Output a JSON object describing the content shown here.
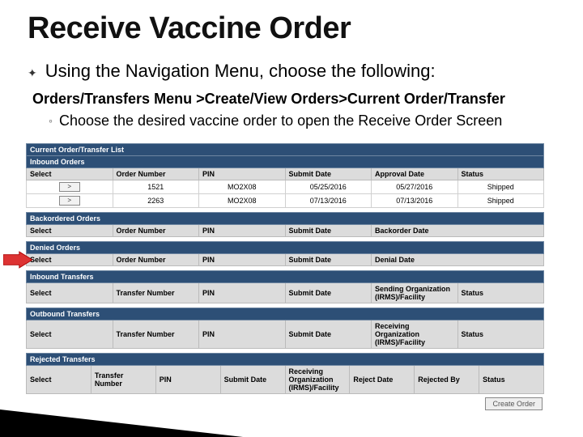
{
  "title": "Receive Vaccine Order",
  "bullet1": "Using the Navigation Menu, choose the following:",
  "menupath": "Orders/Transfers Menu >Create/View Orders>Current Order/Transfer",
  "bullet2": "Choose the desired vaccine order to open the Receive Order Screen",
  "shot": {
    "section1_title": "Current Order/Transfer List",
    "inbound_orders": {
      "title": "Inbound Orders",
      "columns": [
        "Select",
        "Order Number",
        "PIN",
        "Submit Date",
        "Approval Date",
        "Status"
      ],
      "rows": [
        {
          "select": ">",
          "order_number": "1521",
          "pin": "MO2X08",
          "submit_date": "05/25/2016",
          "approval_date": "05/27/2016",
          "status": "Shipped"
        },
        {
          "select": ">",
          "order_number": "2263",
          "pin": "MO2X08",
          "submit_date": "07/13/2016",
          "approval_date": "07/13/2016",
          "status": "Shipped"
        }
      ]
    },
    "backordered_orders": {
      "title": "Backordered Orders",
      "columns": [
        "Select",
        "Order Number",
        "PIN",
        "Submit Date",
        "Backorder Date"
      ]
    },
    "denied_orders": {
      "title": "Denied Orders",
      "columns": [
        "Select",
        "Order Number",
        "PIN",
        "Submit Date",
        "Denial Date"
      ]
    },
    "inbound_transfers": {
      "title": "Inbound Transfers",
      "columns": [
        "Select",
        "Transfer Number",
        "PIN",
        "Submit Date",
        "Sending Organization (IRMS)/Facility",
        "Status"
      ]
    },
    "outbound_transfers": {
      "title": "Outbound Transfers",
      "columns": [
        "Select",
        "Transfer Number",
        "PIN",
        "Submit Date",
        "Receiving Organization (IRMS)/Facility",
        "Status"
      ]
    },
    "rejected_transfers": {
      "title": "Rejected Transfers",
      "columns": [
        "Select",
        "Transfer Number",
        "PIN",
        "Submit Date",
        "Receiving Organization (IRMS)/Facility",
        "Reject Date",
        "Rejected By",
        "Status"
      ]
    },
    "create_order_btn": "Create Order"
  }
}
